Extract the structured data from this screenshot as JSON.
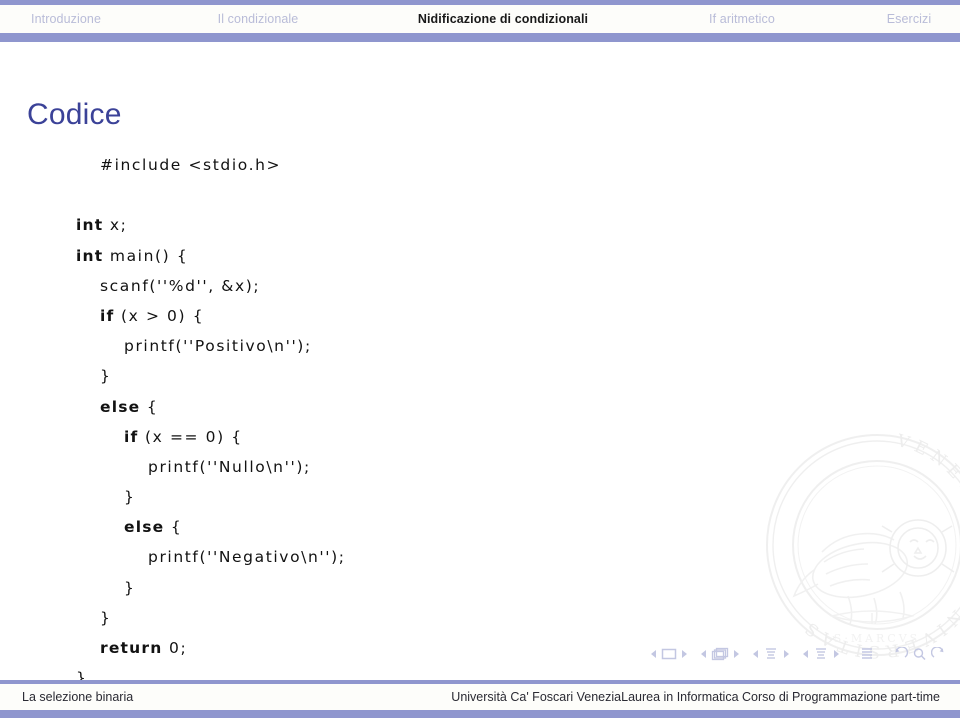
{
  "header": {
    "tabs": [
      {
        "label": "Introduzione",
        "active": false
      },
      {
        "label": "Il condizionale",
        "active": false
      },
      {
        "label": "Nidificazione di condizionali",
        "active": true
      },
      {
        "label": "If aritmetico",
        "active": false
      },
      {
        "label": "Esercizi",
        "active": false
      }
    ]
  },
  "slide": {
    "title": "Codice",
    "code_lines": [
      {
        "indent": 1,
        "segments": [
          {
            "text": "#include <stdio.h>",
            "bold": false
          }
        ]
      },
      {
        "indent": 0,
        "segments": [
          {
            "text": "",
            "bold": false
          }
        ]
      },
      {
        "indent": 0,
        "segments": [
          {
            "text": "int",
            "bold": true
          },
          {
            "text": " x;",
            "bold": false
          }
        ]
      },
      {
        "indent": 0,
        "segments": [
          {
            "text": "int",
            "bold": true
          },
          {
            "text": " main() {",
            "bold": false
          }
        ]
      },
      {
        "indent": 1,
        "segments": [
          {
            "text": "scanf(''%d'', &x);",
            "bold": false
          }
        ]
      },
      {
        "indent": 1,
        "segments": [
          {
            "text": "if",
            "bold": true
          },
          {
            "text": " (x > 0) {",
            "bold": false
          }
        ]
      },
      {
        "indent": 2,
        "segments": [
          {
            "text": "printf(''Positivo\\n'');",
            "bold": false
          }
        ]
      },
      {
        "indent": 1,
        "segments": [
          {
            "text": "}",
            "bold": false
          }
        ]
      },
      {
        "indent": 1,
        "segments": [
          {
            "text": "else",
            "bold": true
          },
          {
            "text": " {",
            "bold": false
          }
        ]
      },
      {
        "indent": 2,
        "segments": [
          {
            "text": "if",
            "bold": true
          },
          {
            "text": " (x == 0) {",
            "bold": false
          }
        ]
      },
      {
        "indent": 3,
        "segments": [
          {
            "text": "printf(''Nullo\\n'');",
            "bold": false
          }
        ]
      },
      {
        "indent": 2,
        "segments": [
          {
            "text": "}",
            "bold": false
          }
        ]
      },
      {
        "indent": 2,
        "segments": [
          {
            "text": "else",
            "bold": true
          },
          {
            "text": " {",
            "bold": false
          }
        ]
      },
      {
        "indent": 3,
        "segments": [
          {
            "text": "printf(''Negativo\\n'');",
            "bold": false
          }
        ]
      },
      {
        "indent": 2,
        "segments": [
          {
            "text": "}",
            "bold": false
          }
        ]
      },
      {
        "indent": 1,
        "segments": [
          {
            "text": "}",
            "bold": false
          }
        ]
      },
      {
        "indent": 1,
        "segments": [
          {
            "text": "return",
            "bold": true
          },
          {
            "text": " 0;",
            "bold": false
          }
        ]
      },
      {
        "indent": 0,
        "segments": [
          {
            "text": "}",
            "bold": false
          }
        ]
      }
    ]
  },
  "navsymbols": {
    "groups": [
      {
        "icon": "slide-icon",
        "prev": "prev-slide-arrow",
        "next": "next-slide-arrow"
      },
      {
        "icon": "frame-stack-icon",
        "prev": "prev-frame-arrow",
        "next": "next-frame-arrow"
      },
      {
        "icon": "subsection-icon",
        "prev": "prev-subsection-arrow",
        "next": "next-subsection-arrow"
      },
      {
        "icon": "section-icon",
        "prev": "prev-section-arrow",
        "next": "next-section-arrow"
      }
    ],
    "document_icon": "document-icon",
    "back_icon": "back-arrow-icon",
    "search_icon": "search-icon",
    "forward_icon": "forward-arrow-icon"
  },
  "watermark": {
    "name": "universita-ca-foscari-seal",
    "ring_text": "VENETIARUM  UNIVERSITAS"
  },
  "footer": {
    "left": "La selezione binaria",
    "right": "Università Ca' Foscari VeneziaLaurea in Informatica Corso di Programmazione part-time"
  },
  "colors": {
    "band": "#8f96ce",
    "band_light": "#fdfdfa",
    "title": "#3b4298",
    "tab_inactive": "#b9bcd8",
    "tab_active": "#1a1a1a",
    "code": "#121212",
    "nav_symbol": "#c3c7e2"
  }
}
